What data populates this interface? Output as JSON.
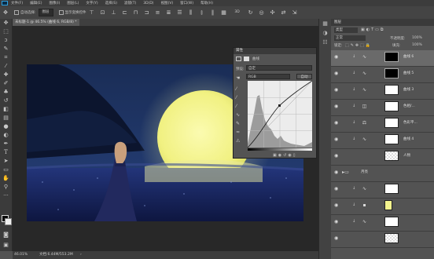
{
  "menu": [
    "文件(F)",
    "编辑(E)",
    "图像(I)",
    "图层(L)",
    "文字(Y)",
    "选择(S)",
    "滤镜(T)",
    "3D(D)",
    "视图(V)",
    "窗口(W)",
    "帮助(H)"
  ],
  "options": {
    "auto_select_label": "自动选择:",
    "group_value": "图层",
    "transform_label": "显示变换控件"
  },
  "document": {
    "tab": "未标题-1 @ 46.5% (曲线 6, RGB/8) *"
  },
  "status": {
    "zoom": "46.01%",
    "doc_info": "文档:6.44M/553.2M"
  },
  "properties": {
    "title": "属性",
    "adjustment_label": "曲线",
    "preset_label": "预设:",
    "preset_value": "自定",
    "channel_value": "RGB",
    "auto_button": "自动"
  },
  "layers": {
    "title": "图层",
    "kind_label": "类型",
    "blend_mode": "正常",
    "opacity_label": "不透明度:",
    "opacity_value": "100%",
    "lock_label": "锁定:",
    "fill_label": "填充:",
    "fill_value": "100%",
    "rows": [
      {
        "name": "曲线 6",
        "kind": "curves",
        "mask": "dark",
        "selected": true
      },
      {
        "name": "曲线 5",
        "kind": "curves",
        "mask": "dark",
        "selected": false
      },
      {
        "name": "曲线 3",
        "kind": "curves",
        "mask": "white",
        "selected": false
      },
      {
        "name": "色相/...",
        "kind": "hue",
        "mask": "white",
        "selected": false
      },
      {
        "name": "色彩平...",
        "kind": "balance",
        "mask": "white",
        "selected": false
      },
      {
        "name": "曲线 4",
        "kind": "curves",
        "mask": "white",
        "selected": false
      },
      {
        "name": "人物",
        "kind": "pixel",
        "mask": "none",
        "selected": false
      },
      {
        "name": "月亮",
        "kind": "group",
        "mask": "none",
        "selected": false
      },
      {
        "name": "",
        "kind": "curves",
        "mask": "white",
        "selected": false
      },
      {
        "name": "",
        "kind": "color",
        "mask": "yellow",
        "selected": false
      },
      {
        "name": "",
        "kind": "curves",
        "mask": "white",
        "selected": false
      },
      {
        "name": "",
        "kind": "pixel",
        "mask": "none",
        "selected": false
      }
    ]
  },
  "colors": {
    "moon": "#f4f48e",
    "sky": "#1a2e57",
    "field": "#16245a",
    "accent": "#2fa0e0"
  }
}
